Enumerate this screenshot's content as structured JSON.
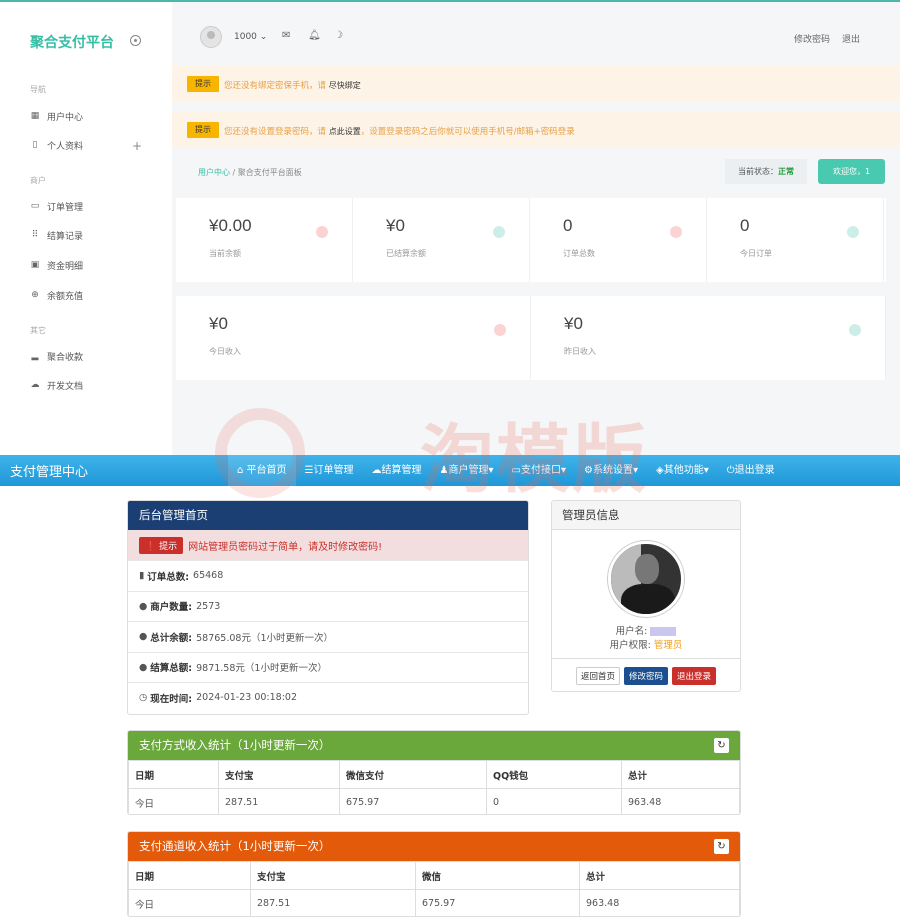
{
  "merchant": {
    "brand": "聚合支付平台",
    "nav_sections": [
      "导航",
      "商户",
      "其它"
    ],
    "nav_items": [
      "用户中心",
      "个人资料",
      "订单管理",
      "结算记录",
      "资金明细",
      "余额充值",
      "聚合收款",
      "开发文档"
    ],
    "user": "1000",
    "top_links": [
      "修改密码",
      "退出"
    ],
    "alerts": [
      {
        "badge": "提示",
        "text": "您还没有绑定密保手机，请",
        "action": "尽快绑定",
        "tail": ""
      },
      {
        "badge": "提示",
        "text": "您还没有设置登录密码，请",
        "action": "点此设置",
        "tail": "，设置登录密码之后你就可以使用手机号/邮箱+密码登录"
      }
    ],
    "breadcrumb": [
      "用户中心",
      "聚合支付平台面板"
    ],
    "status_label": "当前状态：",
    "status_value": "正常",
    "welcome": "欢迎您，1",
    "stats_row1": [
      {
        "value": "¥0.00",
        "label": "当前余额",
        "color": "#fbd3d3"
      },
      {
        "value": "¥0",
        "label": "已结算余额",
        "color": "#cdeee8"
      },
      {
        "value": "0",
        "label": "订单总数",
        "color": "#fbd3d3"
      },
      {
        "value": "0",
        "label": "今日订单",
        "color": "#cdeee8"
      }
    ],
    "stats_row2": [
      {
        "value": "¥0",
        "label": "今日收入",
        "color": "#fbd3d3"
      },
      {
        "value": "¥0",
        "label": "昨日收入",
        "color": "#cdeee8"
      }
    ]
  },
  "watermark": "淘模版",
  "admin": {
    "title": "支付管理中心",
    "nav": [
      "平台首页",
      "订单管理",
      "结算管理",
      "商户管理▾",
      "支付接口▾",
      "系统设置▾",
      "其他功能▾",
      "退出登录"
    ],
    "home_panel": {
      "title": "后台管理首页",
      "warn_label": "提示",
      "warn_text": "网站管理员密码过于简单，请及时修改密码!",
      "rows": [
        {
          "label": "订单总数:",
          "value": "65468"
        },
        {
          "label": "商户数量:",
          "value": "2573"
        },
        {
          "label": "总计余额:",
          "value": "58765.08元（1小时更新一次）"
        },
        {
          "label": "结算总额:",
          "value": "9871.58元（1小时更新一次）"
        },
        {
          "label": "现在时间:",
          "value": "2024-01-23 00:18:02"
        }
      ]
    },
    "admin_info": {
      "title": "管理员信息",
      "username_label": "用户名:",
      "role_label": "用户权限:",
      "role": "管理员",
      "buttons": [
        "返回首页",
        "修改密码",
        "退出登录"
      ]
    },
    "pay_method_table": {
      "title": "支付方式收入统计（1小时更新一次）",
      "headers": [
        "日期",
        "支付宝",
        "微信支付",
        "QQ钱包",
        "总计"
      ],
      "rows": [
        [
          "今日",
          "287.51",
          "675.97",
          "0",
          "963.48"
        ]
      ]
    },
    "pay_channel_table": {
      "title": "支付通道收入统计（1小时更新一次）",
      "headers": [
        "日期",
        "支付宝",
        "微信",
        "总计"
      ],
      "rows": [
        [
          "今日",
          "287.51",
          "675.97",
          "963.48"
        ]
      ]
    }
  }
}
